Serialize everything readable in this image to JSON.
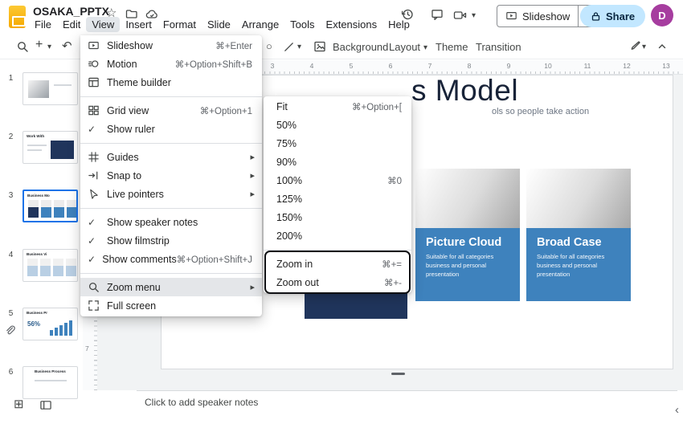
{
  "icons": {
    "caret_down": "▾",
    "submenu_arrow": "▸",
    "check": "✓",
    "star": "☆",
    "undo": "↶",
    "plus": "+",
    "shape": "○",
    "grid_squared": "⊞",
    "chevron_left": "‹"
  },
  "colors": {
    "accent_blue": "#1a73e8",
    "share_bg": "#c2e7ff",
    "share_text": "#08263f",
    "card_blue": "#3e82bd",
    "card_navy": "#20355c",
    "avatar": "#a63d9f"
  },
  "titlebar": {
    "title": "OSAKA_PPTX",
    "menus": [
      "File",
      "Edit",
      "View",
      "Insert",
      "Format",
      "Slide",
      "Arrange",
      "Tools",
      "Extensions",
      "Help"
    ],
    "slideshow_label": "Slideshow",
    "share_label": "Share",
    "avatar_initial": "D"
  },
  "toolbar": {
    "background_label": "Background",
    "layout_label": "Layout",
    "theme_label": "Theme",
    "transition_label": "Transition"
  },
  "view_menu": {
    "items": [
      {
        "label": "Slideshow",
        "shortcut": "⌘+Enter"
      },
      {
        "label": "Motion",
        "shortcut": "⌘+Option+Shift+B"
      },
      {
        "label": "Theme builder"
      },
      {
        "label": "Grid view",
        "shortcut": "⌘+Option+1"
      },
      {
        "label": "Show ruler",
        "checked": true
      },
      {
        "label": "Guides",
        "submenu": true
      },
      {
        "label": "Snap to",
        "submenu": true
      },
      {
        "label": "Live pointers",
        "submenu": true
      },
      {
        "label": "Show speaker notes",
        "checked": true
      },
      {
        "label": "Show filmstrip",
        "checked": true
      },
      {
        "label": "Show comments",
        "shortcut": "⌘+Option+Shift+J",
        "checked": true
      },
      {
        "label": "Zoom menu",
        "submenu": true,
        "highlighted": true
      },
      {
        "label": "Full screen"
      }
    ]
  },
  "zoom_menu": {
    "items": [
      {
        "label": "Fit",
        "shortcut": "⌘+Option+["
      },
      {
        "label": "50%"
      },
      {
        "label": "75%"
      },
      {
        "label": "90%"
      },
      {
        "label": "100%",
        "shortcut": "⌘0"
      },
      {
        "label": "125%"
      },
      {
        "label": "150%"
      },
      {
        "label": "200%"
      },
      {
        "label": "Zoom in",
        "shortcut": "⌘+="
      },
      {
        "label": "Zoom out",
        "shortcut": "⌘+-"
      }
    ]
  },
  "rulers": {
    "h": [
      "3",
      "4",
      "5",
      "6",
      "7",
      "8",
      "9",
      "10",
      "11",
      "12",
      "13"
    ],
    "v": [
      "7"
    ]
  },
  "filmstrip": {
    "slides": [
      {
        "number": "1",
        "title": ""
      },
      {
        "number": "2",
        "title": "Work With"
      },
      {
        "number": "3",
        "title": "Business Mo"
      },
      {
        "number": "4",
        "title": "Business Vi"
      },
      {
        "number": "5",
        "title": "Business Pr",
        "stat": "56%"
      },
      {
        "number": "6",
        "title": "Business Process"
      }
    ]
  },
  "slide": {
    "title_fragment": "s Model",
    "subtitle_fragment": "ols so people take action",
    "cards": [
      {
        "title": "Picture Cloud",
        "body": "Suitable for all categories business and personal presentation"
      },
      {
        "title": "Broad Case",
        "body": "Suitable for all categories business and personal presentation"
      }
    ]
  },
  "notes": {
    "placeholder": "Click to add speaker notes"
  }
}
